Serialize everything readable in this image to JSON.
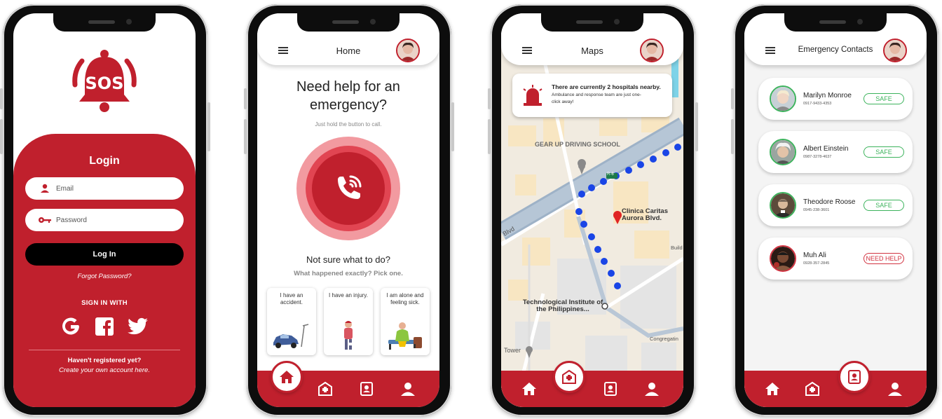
{
  "login": {
    "logo_text": "SOS",
    "title": "Login",
    "email_placeholder": "Email",
    "password_placeholder": "Password",
    "login_button": "Log In",
    "forgot": "Forgot Password?",
    "sign_in_with": "SIGN IN WITH",
    "socials": [
      "google-icon",
      "facebook-icon",
      "twitter-icon"
    ],
    "not_registered": "Haven't registered yet?",
    "create_account": "Create your own account here."
  },
  "home": {
    "title": "Home",
    "question": "Need help for an emergency?",
    "hold_hint": "Just hold the button to call.",
    "not_sure": "Not sure what to do?",
    "what_happened": "What happened exactly? Pick one.",
    "cards": [
      {
        "text": "I have an accident."
      },
      {
        "text": "I have an injury."
      },
      {
        "text": "I am alone and feeling sick."
      }
    ]
  },
  "maps": {
    "title": "Maps",
    "notice_title": "There are currently 2 hospitals nearby.",
    "notice_body": "Ambulance and response team are just one-click away!",
    "labels": {
      "gear_up": "GEAR UP DRIVING SCHOOL",
      "clinica": "Clinica Caritas Aurora Blvd.",
      "tip": "Technological Institute of the Philippines...",
      "tower": "Tower",
      "congregation": "Congregatin",
      "build": "Build",
      "blvd": "Blvd",
      "r6": "R-6"
    }
  },
  "contacts": {
    "title": "Emergency Contacts",
    "list": [
      {
        "name": "Marilyn Monroe",
        "phone": "0917-9433-4353",
        "status": "SAFE"
      },
      {
        "name": "Albert Einstein",
        "phone": "0987-3278-4637",
        "status": "SAFE"
      },
      {
        "name": "Theodore Roose",
        "phone": "0945-238-3601",
        "status": "SAFE"
      },
      {
        "name": "Muh Ali",
        "phone": "0928-357-2845",
        "status": "NEED HELP"
      }
    ]
  },
  "colors": {
    "brand": "#c0202d",
    "safe": "#3cb35c",
    "help": "#d23240"
  }
}
